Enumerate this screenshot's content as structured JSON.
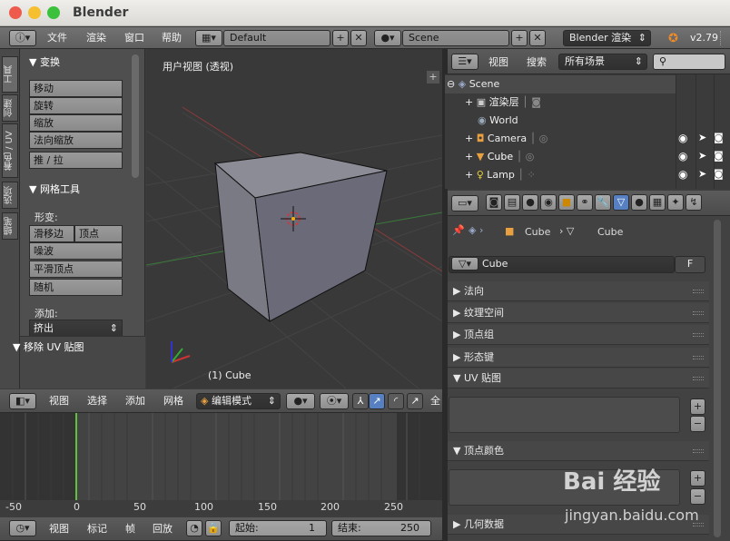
{
  "window": {
    "title": "Blender"
  },
  "info_header": {
    "menus": [
      "文件",
      "渲染",
      "窗口",
      "帮助"
    ],
    "screen_layout": "Default",
    "scene": "Scene",
    "render_engine": "Blender 渲染",
    "version": "v2.79"
  },
  "tool_tabs": [
    "工具",
    "创建",
    "着色 / UV",
    "选项",
    "蜡笔"
  ],
  "tool_shelf": {
    "transform_header": "▼ 变换",
    "transform_buttons": [
      "移动",
      "旋转",
      "缩放",
      "法向缩放",
      "推 / 拉"
    ],
    "mesh_tools_header": "▼ 网格工具",
    "deform_label": "形变:",
    "slide_edge": "滑移边",
    "vertex": "顶点",
    "noise": "噪波",
    "smooth_vertex": "平滑顶点",
    "randomize": "随机",
    "add_label": "添加:",
    "extrude": "挤出",
    "remove_uv": "▼ 移除 UV 贴图"
  },
  "viewport": {
    "view_label": "用户视图 (透视)",
    "object_label": "(1) Cube",
    "plus": "+"
  },
  "view3d_header": {
    "menus": [
      "视图",
      "选择",
      "添加",
      "网格"
    ],
    "mode": "编辑模式",
    "global": "全"
  },
  "timeline": {
    "ticks": [
      "-50",
      "0",
      "50",
      "100",
      "150",
      "200",
      "250"
    ]
  },
  "timeline_header": {
    "menus": [
      "视图",
      "标记",
      "帧",
      "回放"
    ],
    "start_label": "起始:",
    "start_value": "1",
    "end_label": "结束:",
    "end_value": "250"
  },
  "outliner_header": {
    "menus": [
      "视图",
      "搜索"
    ],
    "filter": "所有场景"
  },
  "outliner": [
    {
      "label": "Scene",
      "indent": 0,
      "icon": "scene-icon"
    },
    {
      "label": "渲染层",
      "indent": 1,
      "icon": "render-layers-icon"
    },
    {
      "label": "World",
      "indent": 1,
      "icon": "world-icon"
    },
    {
      "label": "Camera",
      "indent": 1,
      "icon": "camera-icon"
    },
    {
      "label": "Cube",
      "indent": 1,
      "icon": "mesh-icon"
    },
    {
      "label": "Lamp",
      "indent": 1,
      "icon": "lamp-icon"
    }
  ],
  "properties": {
    "breadcrumb_object": "Cube",
    "breadcrumb_data": "Cube",
    "datablock_name": "Cube",
    "fake_user": "F",
    "panels": [
      "▶ 法向",
      "▶ 纹理空间",
      "▶ 顶点组",
      "▶ 形态键",
      "▼ UV 贴图",
      "▼ 顶点颜色",
      "▶ 几何数据"
    ],
    "plus": "+",
    "minus": "−"
  },
  "watermark": {
    "text": "Bai  经验",
    "url": "jingyan.baidu.com"
  }
}
